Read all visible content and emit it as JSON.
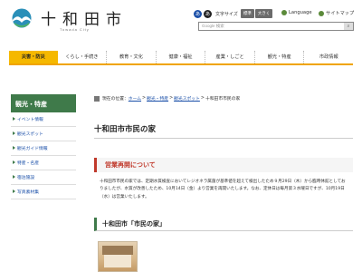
{
  "header": {
    "site_title": "十和田市",
    "site_subtitle": "Towada City",
    "tools": {
      "circle_a": "あ",
      "circle_b": "あ",
      "size_label": "文字サイズ",
      "size_normal": "標準",
      "size_large": "大きく",
      "language": "Language",
      "sitemap": "サイトマップ"
    },
    "search": {
      "placeholder": "Google 検索",
      "button_icon": "search-icon"
    }
  },
  "gnav": {
    "items": [
      {
        "label": "災害・防災",
        "active": true
      },
      {
        "label": "くらし・手続き"
      },
      {
        "label": "教育・文化"
      },
      {
        "label": "健康・福祉"
      },
      {
        "label": "産業・しごと"
      },
      {
        "label": "観光・特産"
      },
      {
        "label": "市政情報"
      }
    ]
  },
  "sidebar": {
    "heading": "観光・特産",
    "items": [
      {
        "label": "イベント情報"
      },
      {
        "label": "観光スポット"
      },
      {
        "label": "観光ガイド情報"
      },
      {
        "label": "特産・名産"
      },
      {
        "label": "宿泊施設"
      },
      {
        "label": "写真素材集"
      }
    ]
  },
  "breadcrumb": {
    "prefix": "現在の位置：",
    "links": [
      "ホーム",
      "観光・特産",
      "観光スポット"
    ],
    "current": "十和田市市民の家"
  },
  "main": {
    "title": "十和田市市民の家",
    "notice_title": "営業再開について",
    "notice_body": "十和田市市民の家では、定期水質検査においてレジオネラ属菌が基準値を超えて検出したため９月29日（木）から臨時休館としておりましたが、水質が改善したため、10月14日（金）より営業を再開いたします。なお、定休日は毎月第３水曜日ですが、10月19日（水）は営業いたします。",
    "section_title": "十和田市「市民の家」"
  },
  "colors": {
    "nav_active": "#f5b800",
    "sidebar_green": "#3f7a4a",
    "notice_red": "#c0392b",
    "link_blue": "#1a4fa8"
  }
}
